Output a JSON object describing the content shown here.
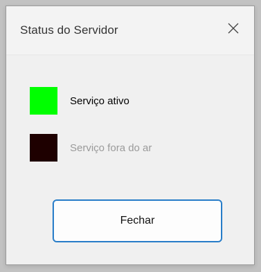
{
  "window": {
    "title": "Status do Servidor",
    "close_icon": "close-icon"
  },
  "legend": {
    "items": [
      {
        "label": "Serviço ativo",
        "color": "#00ff00",
        "state": "active"
      },
      {
        "label": "Serviço fora do ar",
        "color": "#1e0000",
        "state": "inactive"
      }
    ]
  },
  "actions": {
    "close_label": "Fechar"
  },
  "colors": {
    "accent": "#0067c0",
    "active_text": "#000000",
    "inactive_text": "#9a9a9a"
  }
}
